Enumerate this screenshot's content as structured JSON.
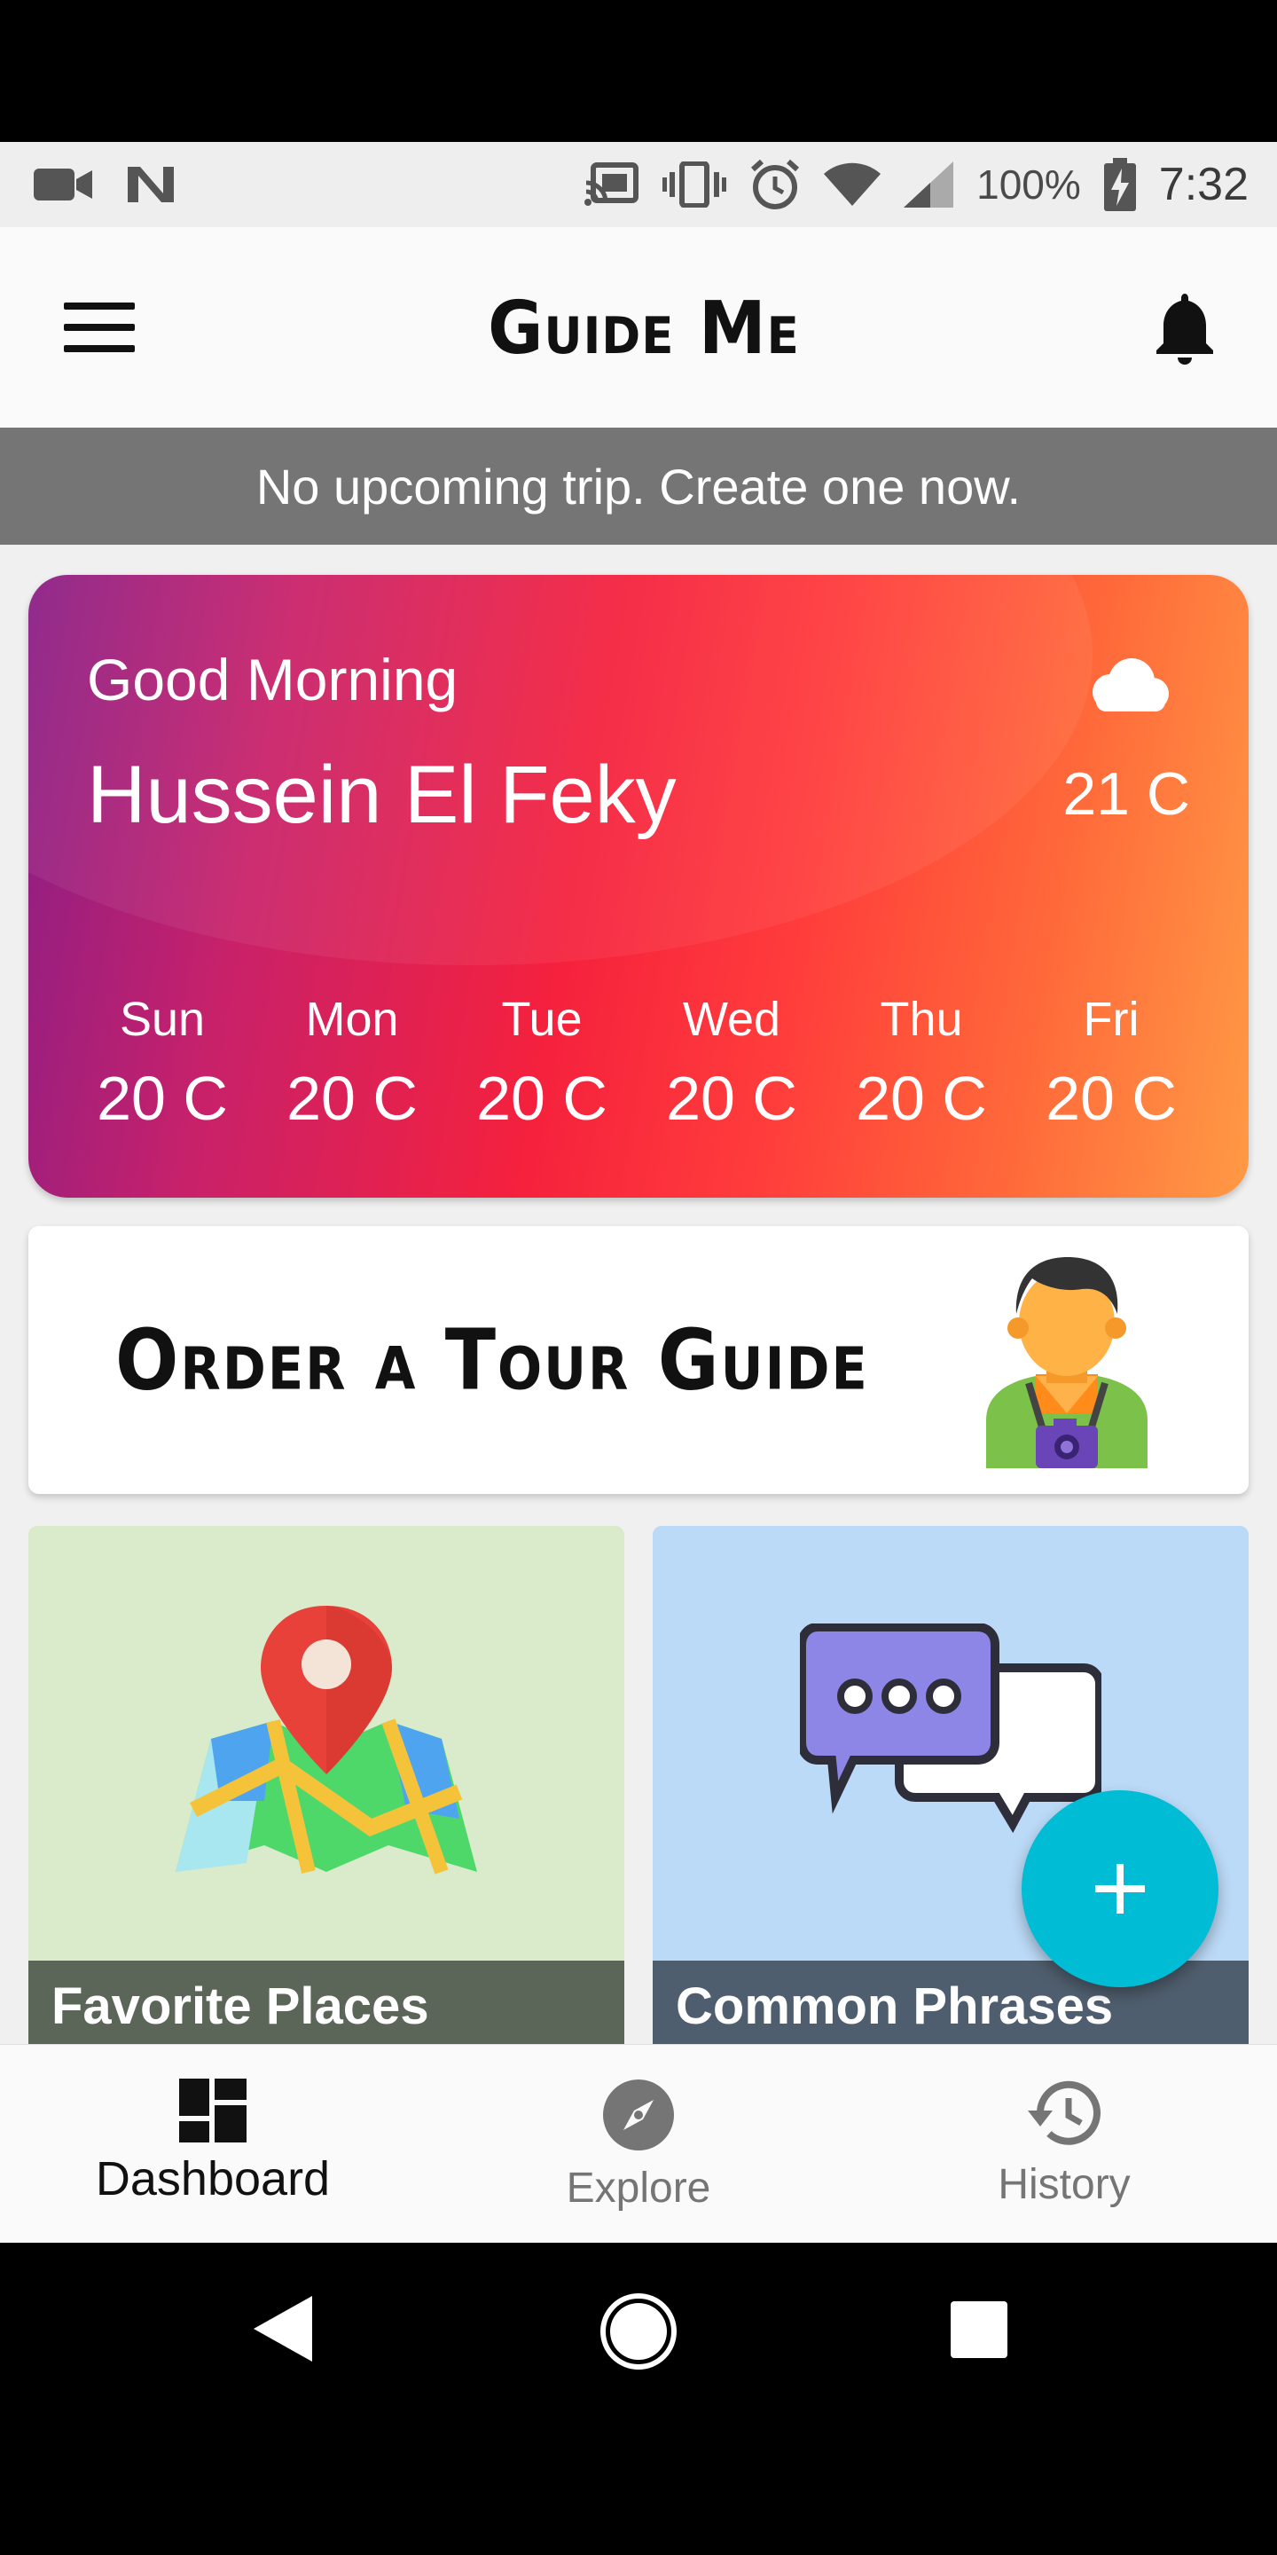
{
  "status_bar": {
    "battery": "100%",
    "time": "7:32"
  },
  "app_bar": {
    "title": "Guide Me"
  },
  "banner": {
    "text": "No upcoming trip. Create one now."
  },
  "weather": {
    "greeting": "Good Morning",
    "user_name": "Hussein El Feky",
    "current_temp": "21 C",
    "current_icon": "cloud-icon",
    "forecast": [
      {
        "day": "Sun",
        "temp": "20 C"
      },
      {
        "day": "Mon",
        "temp": "20 C"
      },
      {
        "day": "Tue",
        "temp": "20 C"
      },
      {
        "day": "Wed",
        "temp": "20 C"
      },
      {
        "day": "Thu",
        "temp": "20 C"
      },
      {
        "day": "Fri",
        "temp": "20 C"
      }
    ]
  },
  "tour_card": {
    "label": "Order a Tour Guide",
    "icon": "tour-guide-icon"
  },
  "tiles": [
    {
      "label": "Favorite Places",
      "icon": "map-pin-icon"
    },
    {
      "label": "Common Phrases",
      "icon": "chat-bubbles-icon"
    }
  ],
  "bottom_nav": [
    {
      "label": "Dashboard",
      "icon": "dashboard-icon",
      "active": true
    },
    {
      "label": "Explore",
      "icon": "compass-icon",
      "active": false
    },
    {
      "label": "History",
      "icon": "history-icon",
      "active": false
    }
  ],
  "colors": {
    "banner": "#757575",
    "fab": "#00bcd4",
    "places_tile": "#d9ebca",
    "phrases_tile": "#bbdaf7"
  }
}
